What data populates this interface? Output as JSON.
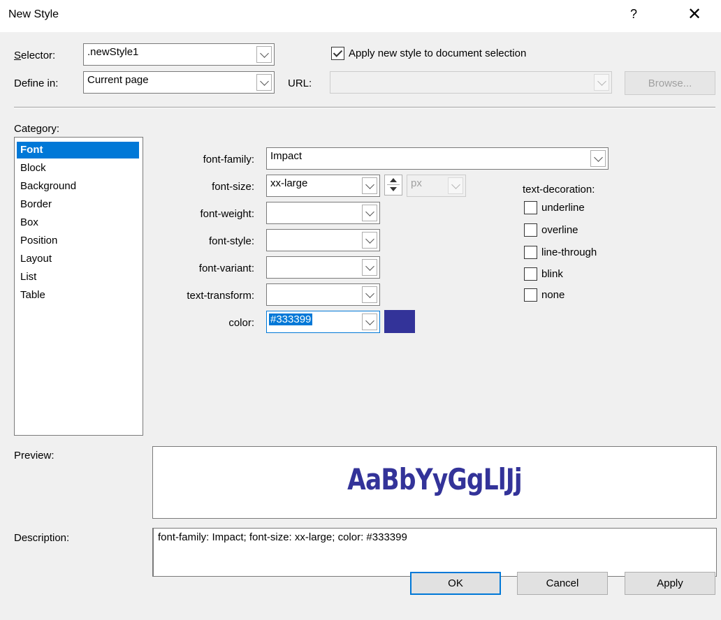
{
  "window": {
    "title": "New Style",
    "help": "?",
    "close": "✕"
  },
  "selector": {
    "label": "Selector:",
    "value": ".newStyle1"
  },
  "apply_new_style": {
    "label": "Apply new style to document selection",
    "checked": true
  },
  "define_in": {
    "label": "Define in:",
    "value": "Current page"
  },
  "url": {
    "label": "URL:",
    "value": ""
  },
  "browse_label": "Browse...",
  "category": {
    "label": "Category:",
    "items": [
      "Font",
      "Block",
      "Background",
      "Border",
      "Box",
      "Position",
      "Layout",
      "List",
      "Table"
    ],
    "selected": "Font"
  },
  "font": {
    "family": {
      "label": "font-family:",
      "value": "Impact"
    },
    "size": {
      "label": "font-size:",
      "value": "xx-large",
      "unit": "px"
    },
    "weight": {
      "label": "font-weight:",
      "value": ""
    },
    "style": {
      "label": "font-style:",
      "value": ""
    },
    "variant": {
      "label": "font-variant:",
      "value": ""
    },
    "transform": {
      "label": "text-transform:",
      "value": ""
    },
    "color": {
      "label": "color:",
      "value": "#333399"
    }
  },
  "text_decoration": {
    "label": "text-decoration:",
    "options": [
      "underline",
      "overline",
      "line-through",
      "blink",
      "none"
    ]
  },
  "preview": {
    "label": "Preview:",
    "text": "AaBbYyGgLlJj"
  },
  "description": {
    "label": "Description:",
    "text": "font-family: Impact; font-size: xx-large; color: #333399"
  },
  "buttons": {
    "ok": "OK",
    "cancel": "Cancel",
    "apply": "Apply"
  },
  "colors": {
    "swatch": "#333399",
    "selection": "#0078d7"
  }
}
